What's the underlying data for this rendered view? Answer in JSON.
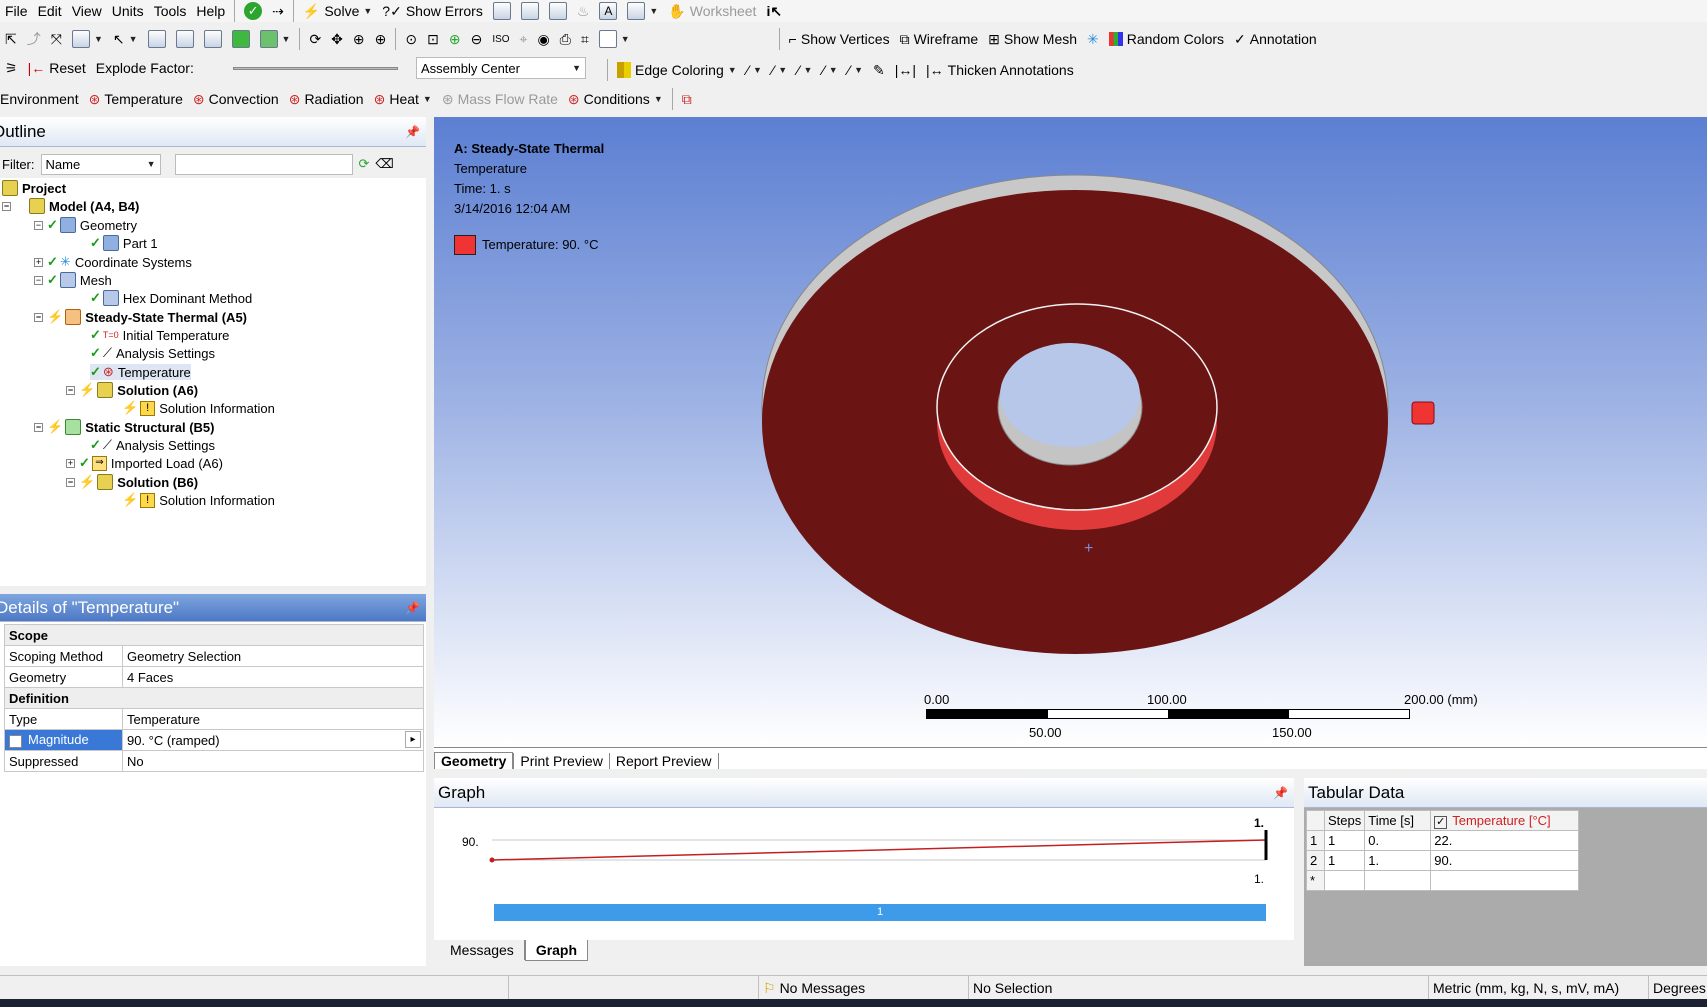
{
  "menu": [
    "File",
    "Edit",
    "View",
    "Units",
    "Tools",
    "Help"
  ],
  "toolbar1": {
    "solve": "Solve",
    "show_errors": "Show Errors",
    "worksheet": "Worksheet"
  },
  "toolbar2": {
    "show_vertices": "Show Vertices",
    "wireframe": "Wireframe",
    "show_mesh": "Show Mesh",
    "random_colors": "Random Colors",
    "annotation": "Annotation"
  },
  "toolbar3": {
    "reset": "Reset",
    "explode_factor": "Explode Factor:",
    "assembly_center": "Assembly Center",
    "edge_coloring": "Edge Coloring",
    "thicken_annotations": "Thicken Annotations"
  },
  "toolbar4": {
    "environment": "Environment",
    "temperature": "Temperature",
    "convection": "Convection",
    "radiation": "Radiation",
    "heat": "Heat",
    "mass_flow_rate": "Mass Flow Rate",
    "conditions": "Conditions"
  },
  "outline": {
    "title": "Outline",
    "filter_label": "Filter:",
    "filter_value": "Name",
    "nodes": [
      "Project",
      "Model (A4, B4)",
      "Geometry",
      "Part 1",
      "Coordinate Systems",
      "Mesh",
      "Hex Dominant Method",
      "Steady-State Thermal (A5)",
      "Initial Temperature",
      "Analysis Settings",
      "Temperature",
      "Solution (A6)",
      "Solution Information",
      "Static Structural (B5)",
      "Analysis Settings",
      "Imported Load (A6)",
      "Solution (B6)",
      "Solution Information"
    ]
  },
  "details": {
    "title": "Details of \"Temperature\"",
    "scope": "Scope",
    "scoping_method_label": "Scoping Method",
    "scoping_method": "Geometry Selection",
    "geometry_label": "Geometry",
    "geometry": "4 Faces",
    "definition": "Definition",
    "type_label": "Type",
    "type": "Temperature",
    "magnitude_label": "Magnitude",
    "magnitude": "90. °C  (ramped)",
    "suppressed_label": "Suppressed",
    "suppressed": "No"
  },
  "viewport": {
    "analysis": "A: Steady-State Thermal",
    "result": "Temperature",
    "time": "Time: 1. s",
    "date": "3/14/2016 12:04 AM",
    "legend": "Temperature: 90. °C",
    "scale": {
      "t0": "0.00",
      "t100": "100.00",
      "t200": "200.00 (mm)",
      "t50": "50.00",
      "t150": "150.00"
    },
    "tabs": [
      "Geometry",
      "Print Preview",
      "Report Preview"
    ]
  },
  "colors": {
    "disk": "#6a1414",
    "ring_highlight": "#e03a3a",
    "background_top": "#5c7fd2",
    "background_bottom": "#ffffff",
    "legend_red": "#f03434",
    "bar_blue": "#3d9be9"
  },
  "graph": {
    "title": "Graph",
    "y_label": "90.",
    "top_right": "1.",
    "bottom_right": "1.",
    "bar_label": "1",
    "tabs": [
      "Messages",
      "Graph"
    ]
  },
  "chart_data": {
    "type": "line",
    "x": [
      0,
      1
    ],
    "y": [
      22,
      90
    ],
    "series": [
      {
        "name": "Temperature [°C]",
        "values": [
          22,
          90
        ]
      }
    ]
  },
  "tabular": {
    "title": "Tabular Data",
    "headers": [
      "Steps",
      "Time [s]",
      "Temperature [°C]"
    ],
    "rows": [
      [
        "1",
        "1",
        "0.",
        "22."
      ],
      [
        "2",
        "1",
        "1.",
        "90."
      ],
      [
        "*",
        "",
        "",
        ""
      ]
    ]
  },
  "status": {
    "messages": "No Messages",
    "selection": "No Selection",
    "units": "Metric (mm, kg, N, s, mV, mA)",
    "angle": "Degrees"
  }
}
